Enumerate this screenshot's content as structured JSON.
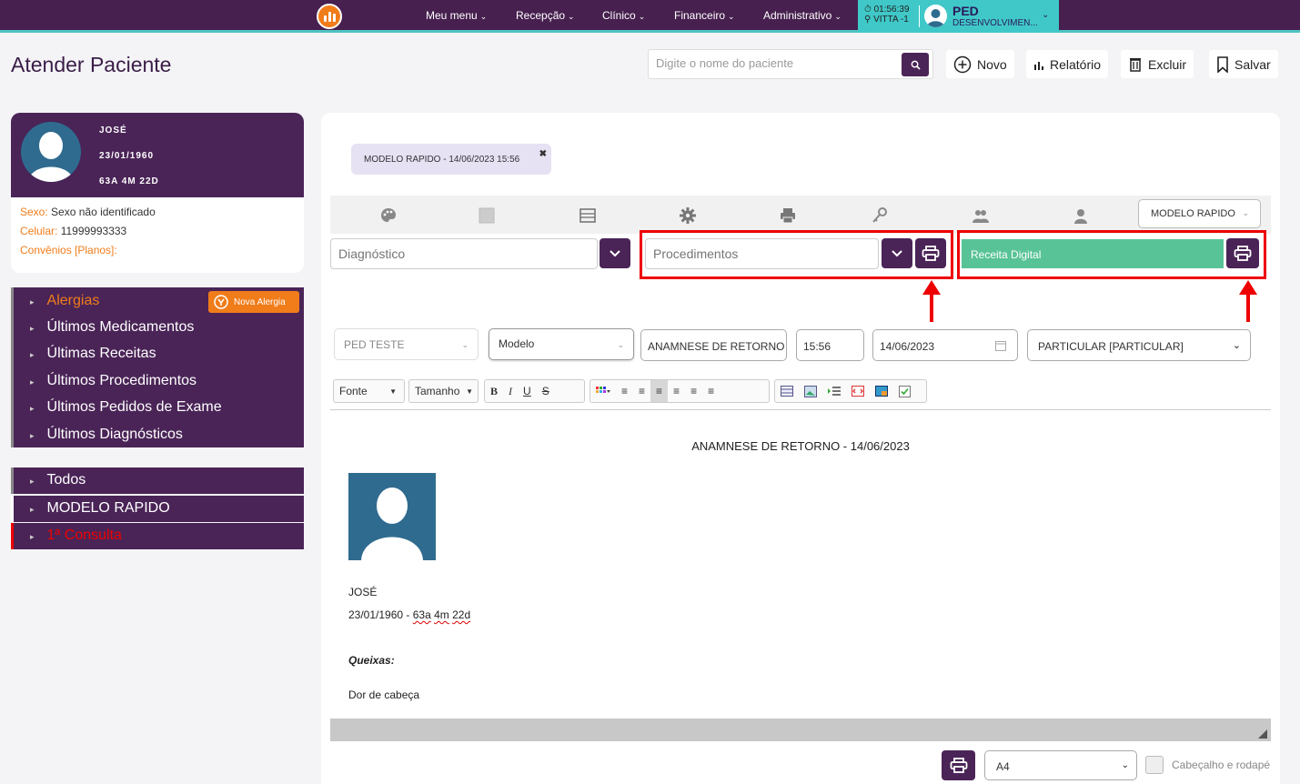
{
  "nav": {
    "items": [
      "Meu menu",
      "Recepção",
      "Clínico",
      "Financeiro",
      "Administrativo"
    ],
    "clock": "01:56:39",
    "location": "VITTA -1",
    "user_name": "PED",
    "user_role": "DESENVOLVIMEN..."
  },
  "header": {
    "title": "Atender Paciente",
    "search_placeholder": "Digite o nome do paciente",
    "novo": "Novo",
    "relatorio": "Relatório",
    "excluir": "Excluir",
    "salvar": "Salvar"
  },
  "patient": {
    "name": "JOSÉ",
    "birth": "23/01/1960",
    "age": "63A 4M 22D",
    "sexo_label": "Sexo:",
    "sexo_value": "Sexo não identificado",
    "celular_label": "Celular:",
    "celular_value": "11999993333",
    "convenios_label": "Convênios [Planos]:"
  },
  "history": {
    "items": [
      "Alergias",
      "Últimos Medicamentos",
      "Últimas Receitas",
      "Últimos Procedimentos",
      "Últimos Pedidos de Exame",
      "Últimos Diagnósticos"
    ],
    "nova_alergia": "Nova Alergia"
  },
  "categories": [
    "Todos",
    "MODELO RAPIDO",
    "1ª Consulta"
  ],
  "main": {
    "chip": "MODELO RAPIDO - 14/06/2023 15:56",
    "modelo_dropdown": "MODELO RAPIDO",
    "diagnostico_placeholder": "Diagnóstico",
    "procedimentos_placeholder": "Procedimentos",
    "receita": "Receita Digital",
    "profissional": "PED TESTE",
    "modelo": "Modelo",
    "tipo": "ANAMNESE DE RETORNO",
    "hora": "15:56",
    "data": "14/06/2023",
    "convenio": "PARTICULAR [PARTICULAR]"
  },
  "editor": {
    "fonte": "Fonte",
    "tamanho": "Tamanho"
  },
  "doc": {
    "title": "ANAMNESE DE RETORNO - 14/06/2023",
    "name": "JOSÉ",
    "birth": "23/01/1960 - ",
    "age_a": "63a",
    "age_m": "4m",
    "age_d": "22d",
    "queixas": "Queixas:",
    "queixa_text": "Dor de cabeça"
  },
  "footer": {
    "paper": "A4",
    "header_footer": "Cabeçalho e rodapé"
  },
  "colors": {
    "primary": "#4a2457",
    "accent": "#f07c1a",
    "teal": "#40c8c8",
    "green": "#58c396",
    "highlight": "#e00000"
  }
}
